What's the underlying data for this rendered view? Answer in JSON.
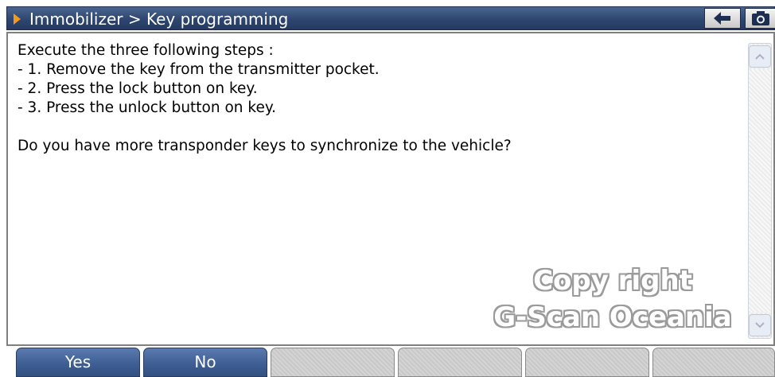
{
  "titlebar": {
    "title": "Immobilizer > Key programming",
    "back_icon": "back-arrow-icon",
    "capture_icon": "camera-icon"
  },
  "message": {
    "lines": [
      "Execute the three following steps :",
      "- 1. Remove the key from the transmitter pocket.",
      "- 2. Press the lock button on key.",
      "- 3. Press the unlock button on key.",
      "",
      "Do you have more transponder keys to synchronize to the vehicle?"
    ]
  },
  "watermark": {
    "line1": "Copy right",
    "line2": "G-Scan Oceania"
  },
  "buttons": {
    "yes": "Yes",
    "no": "No"
  },
  "colors": {
    "titlebar": "#2e4670",
    "accent_arrow": "#f39a1c",
    "active_button": "#3d5c92"
  }
}
